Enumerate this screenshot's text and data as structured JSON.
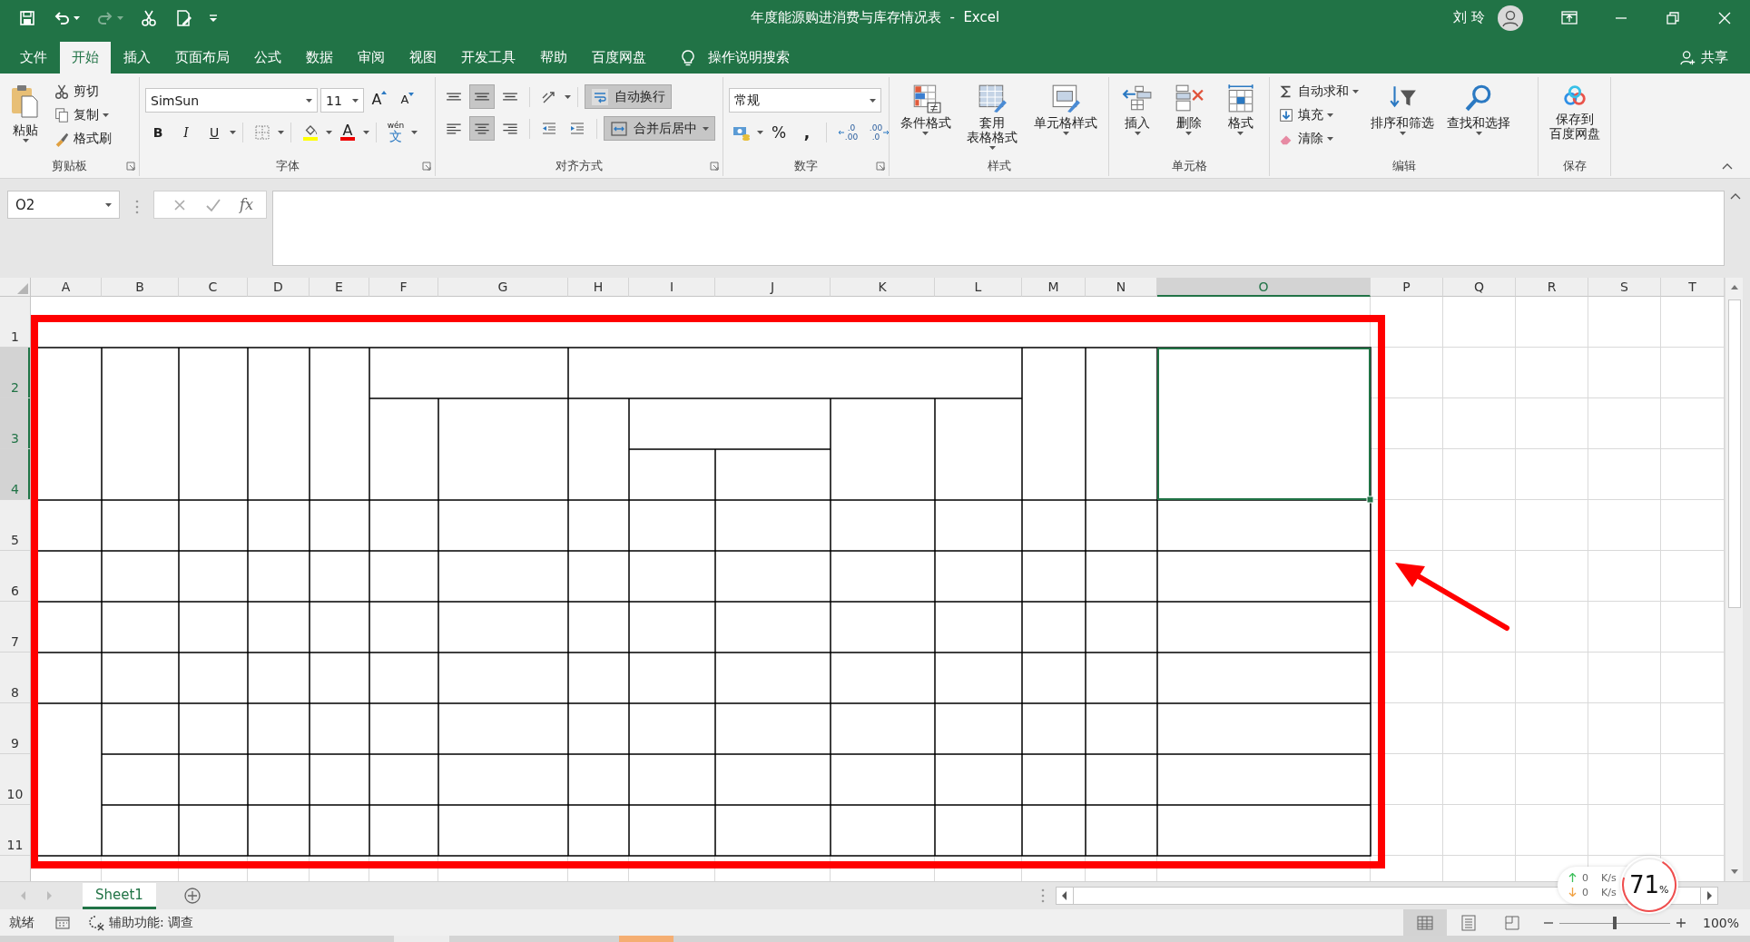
{
  "window": {
    "title": "年度能源购进消费与库存情况表  -  Excel",
    "user": "刘 玲"
  },
  "quick_access": [
    {
      "kind": "save",
      "disabled": false
    },
    {
      "kind": "undo",
      "disabled": false
    },
    {
      "kind": "redo",
      "disabled": true
    },
    {
      "kind": "cut",
      "disabled": false
    },
    {
      "kind": "preview",
      "disabled": false
    },
    {
      "kind": "customize",
      "disabled": false
    }
  ],
  "menu_tabs": [
    {
      "label": "文件",
      "selected": false
    },
    {
      "label": "开始",
      "selected": true
    },
    {
      "label": "插入",
      "selected": false
    },
    {
      "label": "页面布局",
      "selected": false
    },
    {
      "label": "公式",
      "selected": false
    },
    {
      "label": "数据",
      "selected": false
    },
    {
      "label": "审阅",
      "selected": false
    },
    {
      "label": "视图",
      "selected": false
    },
    {
      "label": "开发工具",
      "selected": false
    },
    {
      "label": "帮助",
      "selected": false
    },
    {
      "label": "百度网盘",
      "selected": false
    }
  ],
  "tell_me": "操作说明搜索",
  "share": "共享",
  "ribbon": {
    "clipboard": {
      "title": "剪贴板",
      "paste": "粘贴",
      "cut": "剪切",
      "copy": "复制",
      "format_painter": "格式刷"
    },
    "font": {
      "title": "字体",
      "font_name": "SimSun",
      "font_size": "11",
      "grow": "A",
      "shrink": "A",
      "bold": "B",
      "italic": "I",
      "underline": "U",
      "font_color": "A",
      "phonetic_ruby": "wén",
      "phonetic_base": "文"
    },
    "alignment": {
      "title": "对齐方式",
      "vertical": [
        {
          "selected": false
        },
        {
          "selected": true
        },
        {
          "selected": false
        }
      ],
      "horizontal": [
        {
          "selected": false
        },
        {
          "selected": true
        },
        {
          "selected": false
        }
      ],
      "wrap_text": {
        "label": "自动换行",
        "selected": true
      },
      "merge_center": {
        "label": "合并后居中",
        "selected": true
      }
    },
    "number": {
      "title": "数字",
      "format": "常规",
      "percent": "%",
      "comma": ",",
      "increase_decimal": [
        ".0",
        ".00"
      ],
      "decrease_decimal": [
        ".00",
        ".0"
      ]
    },
    "styles": {
      "title": "样式",
      "buttons": [
        {
          "kind": "conditional",
          "lines": [
            "条件格式"
          ]
        },
        {
          "kind": "table",
          "lines": [
            "套用",
            "表格格式"
          ]
        },
        {
          "kind": "cell",
          "lines": [
            "单元格样式"
          ]
        }
      ]
    },
    "cells": {
      "title": "单元格",
      "buttons": [
        {
          "kind": "insert",
          "label": "插入"
        },
        {
          "kind": "delete",
          "label": "删除"
        },
        {
          "kind": "format",
          "label": "格式"
        }
      ]
    },
    "editing": {
      "title": "编辑",
      "small": [
        {
          "kind": "sum",
          "label": "自动求和"
        },
        {
          "kind": "fill",
          "label": "填充"
        },
        {
          "kind": "clear",
          "label": "清除"
        }
      ],
      "large": [
        {
          "kind": "sort",
          "label": "排序和筛选"
        },
        {
          "kind": "find",
          "label": "查找和选择"
        }
      ]
    },
    "save": {
      "title": "保存",
      "lines": [
        "保存到",
        "百度网盘"
      ]
    }
  },
  "formula_bar": {
    "name_box": "O2",
    "fx": "fx"
  },
  "sheet": {
    "columns": [
      {
        "label": "A",
        "selected": false
      },
      {
        "label": "B",
        "selected": false
      },
      {
        "label": "C",
        "selected": false
      },
      {
        "label": "D",
        "selected": false
      },
      {
        "label": "E",
        "selected": false
      },
      {
        "label": "F",
        "selected": false
      },
      {
        "label": "G",
        "selected": false
      },
      {
        "label": "H",
        "selected": false
      },
      {
        "label": "I",
        "selected": false
      },
      {
        "label": "J",
        "selected": false
      },
      {
        "label": "K",
        "selected": false
      },
      {
        "label": "L",
        "selected": false
      },
      {
        "label": "M",
        "selected": false
      },
      {
        "label": "N",
        "selected": false
      },
      {
        "label": "O",
        "selected": true
      },
      {
        "label": "P",
        "selected": false
      },
      {
        "label": "Q",
        "selected": false
      },
      {
        "label": "R",
        "selected": false
      },
      {
        "label": "S",
        "selected": false
      },
      {
        "label": "T",
        "selected": false
      }
    ],
    "rows": [
      {
        "label": "1",
        "selected": false
      },
      {
        "label": "2",
        "selected": true
      },
      {
        "label": "3",
        "selected": true
      },
      {
        "label": "4",
        "selected": true
      },
      {
        "label": "5",
        "selected": false
      },
      {
        "label": "6",
        "selected": false
      },
      {
        "label": "7",
        "selected": false
      },
      {
        "label": "8",
        "selected": false
      },
      {
        "label": "9",
        "selected": false
      },
      {
        "label": "10",
        "selected": false
      },
      {
        "label": "11",
        "selected": false
      }
    ],
    "highlight_frame": true,
    "pointer_arrow": true
  },
  "sheet_tabs": [
    {
      "label": "Sheet1",
      "selected": true
    }
  ],
  "status_bar": {
    "status": "就绪",
    "accessibility": "辅助功能: 调查",
    "views": [
      {
        "kind": "normal",
        "selected": true
      },
      {
        "kind": "page_layout",
        "selected": false
      },
      {
        "kind": "page_break",
        "selected": false
      }
    ],
    "zoom": {
      "level": 0.5,
      "label": "100%"
    }
  },
  "net_monitor": {
    "upload": "0",
    "upload_unit": "K/s",
    "download": "0",
    "download_unit": "K/s",
    "usage": "71",
    "usage_unit": "%"
  }
}
